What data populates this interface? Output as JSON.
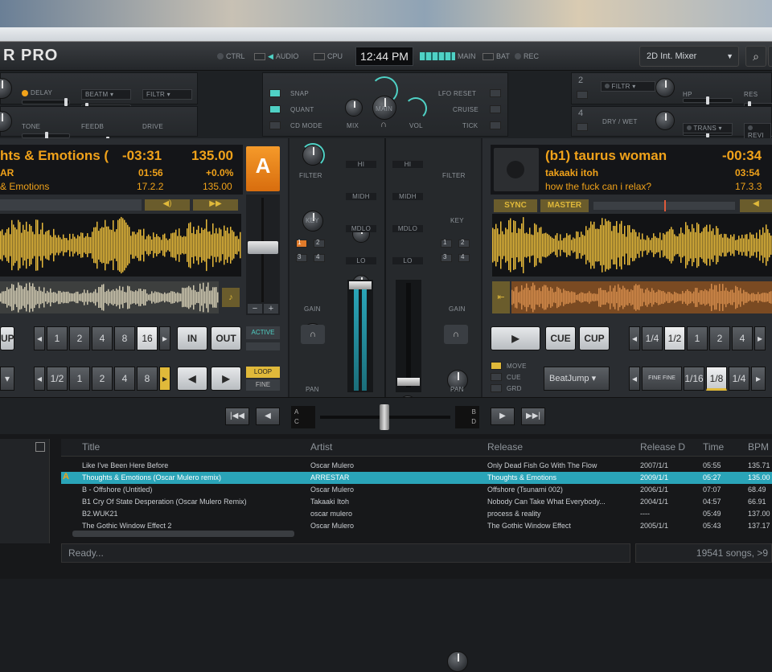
{
  "topbar": {
    "logo": "R PRO",
    "ctrl": "CTRL",
    "audio": "AUDIO",
    "cpu": "CPU",
    "clock": "12:44 PM",
    "main": "MAIN",
    "bat": "BAT",
    "rec": "REC",
    "mixer_mode": "2D Int. Mixer"
  },
  "fx_left": {
    "row1": [
      "DELAY",
      "BEATM",
      "FILTR"
    ],
    "row2": [
      "TONE",
      "FEEDB",
      "DRIVE"
    ]
  },
  "fx_center": {
    "snap": "SNAP",
    "quant": "QUANT",
    "cd_mode": "CD MODE",
    "main": "MAIN",
    "mix": "MIX",
    "vol": "VOL",
    "lfo_reset": "LFO RESET",
    "cruise": "CRUISE",
    "tick": "TICK"
  },
  "fx_right": {
    "unit2_num": "2",
    "unit2_effect": "FILTR",
    "hp": "HP",
    "res": "RES",
    "unit4_num": "4",
    "dry_wet": "DRY / WET",
    "trans": "TRANS",
    "rev": "REVI"
  },
  "deck_a": {
    "title": "hts & Emotions (",
    "time": "-03:31",
    "bpm": "135.00",
    "artist": "AR",
    "elapsed": "01:56",
    "pitch": "+0.0%",
    "album": "& Emotions",
    "key": "17.2.2",
    "bpm2": "135.00",
    "letter": "A",
    "loop_sizes": [
      "1",
      "2",
      "4",
      "8",
      "16"
    ],
    "in": "IN",
    "out": "OUT",
    "active": "ACTIVE",
    "move_sizes": [
      "1/2",
      "1",
      "2",
      "4",
      "8"
    ],
    "loop": "LOOP",
    "fine": "FINE",
    "cup": "UP"
  },
  "deck_b": {
    "title": "(b1) taurus woman",
    "time": "-00:34",
    "artist": "takaaki itoh",
    "elapsed": "03:54",
    "album": "how the fuck can i relax?",
    "key": "17.3.3",
    "sync": "SYNC",
    "master": "MASTER",
    "cue": "CUE",
    "cup": "CUP",
    "loop_sizes": [
      "1/4",
      "1/2",
      "1",
      "2",
      "4"
    ],
    "move": "MOVE",
    "cue2": "CUE",
    "grid": "GRD",
    "beatjump": "BeatJump",
    "fine_fine": "FINE FINE",
    "jump_sizes": [
      "1/16",
      "1/8",
      "1/4"
    ]
  },
  "mixer": {
    "filter": "FILTER",
    "key": "KEY",
    "hi": "HI",
    "mid_hi": "MIDH",
    "mid_lo": "MDLO",
    "lo": "LO",
    "gain": "GAIN",
    "pan": "PAN",
    "fx_assign": [
      "1",
      "2",
      "3",
      "4"
    ]
  },
  "crossfader": {
    "a": "A",
    "c": "C",
    "b": "B",
    "d": "D"
  },
  "browser": {
    "columns": [
      "Title",
      "Artist",
      "Release",
      "Release D",
      "Time",
      "BPM"
    ],
    "rows": [
      {
        "title": "Like I've Been Here Before",
        "artist": "Oscar Mulero",
        "release": "Only Dead Fish Go With The Flow",
        "date": "2007/1/1",
        "time": "05:55",
        "bpm": "135.71"
      },
      {
        "title": "Thoughts & Emotions (Oscar Mulero remix)",
        "artist": "ARRESTAR",
        "release": "Thoughts & Emotions",
        "date": "2009/1/1",
        "time": "05:27",
        "bpm": "135.00"
      },
      {
        "title": "B - Offshore (Untitled)",
        "artist": "Oscar Mulero",
        "release": "Offshore (Tsunami 002)",
        "date": "2006/1/1",
        "time": "07:07",
        "bpm": "68.49"
      },
      {
        "title": "B1 Cry Of State Desperation (Oscar Mulero Remix)",
        "artist": "Takaaki Itoh",
        "release": "Nobody Can Take What Everybody...",
        "date": "2004/1/1",
        "time": "04:57",
        "bpm": "66.91"
      },
      {
        "title": "B2.WUK21",
        "artist": "oscar mulero",
        "release": "process & reality",
        "date": "----",
        "time": "05:49",
        "bpm": "137.00"
      },
      {
        "title": "The Gothic Window Effect 2",
        "artist": "Oscar Mulero",
        "release": "The Gothic Window Effect",
        "date": "2005/1/1",
        "time": "05:43",
        "bpm": "137.17"
      }
    ],
    "deck_marker": "A",
    "status": "Ready...",
    "count": "19541 songs, >9"
  }
}
